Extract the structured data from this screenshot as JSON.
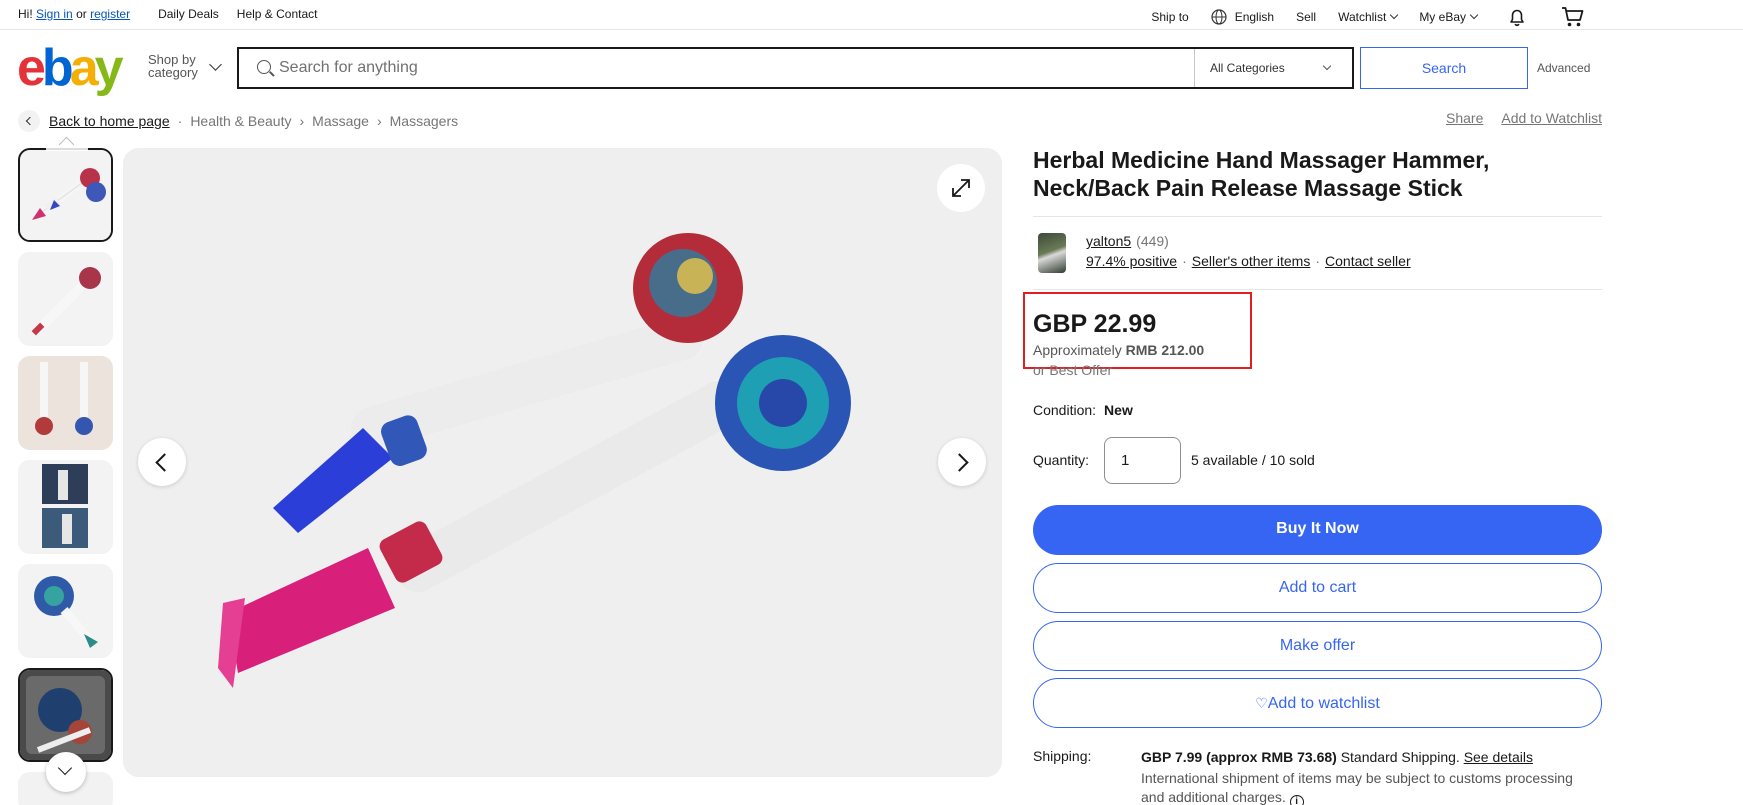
{
  "topbar": {
    "greeting": "Hi!",
    "sign_in": "Sign in",
    "or": "or",
    "register": "register",
    "daily_deals": "Daily Deals",
    "help_contact": "Help & Contact",
    "ship_to": "Ship to",
    "language": "English",
    "sell": "Sell",
    "watchlist": "Watchlist",
    "my_ebay": "My eBay"
  },
  "header": {
    "logo": [
      "e",
      "b",
      "a",
      "y"
    ],
    "shop_by": "Shop by",
    "category": "category",
    "search_placeholder": "Search for anything",
    "category_select": "All Categories",
    "search_button": "Search",
    "advanced": "Advanced"
  },
  "breadcrumb": {
    "back": "Back to home page",
    "items": [
      "Health & Beauty",
      "Massage",
      "Massagers"
    ],
    "share": "Share",
    "add_watchlist": "Add to Watchlist"
  },
  "gallery": {
    "selected_thumbnail": 1,
    "thumbnail_count": 7
  },
  "product": {
    "title": "Herbal Medicine Hand Massager Hammer, Neck/Back Pain Release Massage Stick",
    "seller": {
      "name": "yalton5",
      "feedback_count": "(449)",
      "positive": "97.4% positive",
      "other_items": "Seller's other items",
      "contact": "Contact seller"
    },
    "price": "GBP 22.99",
    "approx_prefix": "Approximately",
    "approx_value": "RMB 212.00",
    "best_offer": "or Best Offer",
    "condition_label": "Condition:",
    "condition_value": "New",
    "quantity_label": "Quantity:",
    "quantity_value": "1",
    "availability": "5 available / 10 sold",
    "buy_now": "Buy It Now",
    "add_cart": "Add to cart",
    "make_offer": "Make offer",
    "add_watchlist": "Add to watchlist",
    "shipping_label": "Shipping:",
    "shipping_price": "GBP 7.99 (approx RMB 73.68)",
    "shipping_type": "Standard Shipping.",
    "see_details": "See details",
    "shipping_note": "International shipment of items may be subject to customs processing and additional charges."
  },
  "colors": {
    "accent": "#3665f3",
    "highlight_box": "#e02020"
  }
}
